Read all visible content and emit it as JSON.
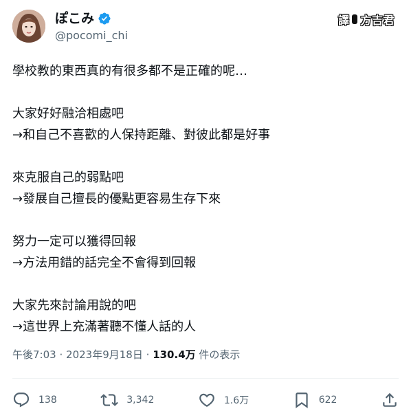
{
  "author": {
    "display_name": "ぽこみ",
    "handle": "@pocomi_chi"
  },
  "watermark": {
    "left": "譯",
    "right": "方吉君"
  },
  "tweet": {
    "lines": [
      "學校教的東西真的有很多都不是正確的呢…",
      "",
      "大家好好融洽相處吧",
      "→和自己不喜歡的人保持距離、對彼此都是好事",
      "",
      "來克服自己的弱點吧",
      "→發展自己擅長的優點更容易生存下來",
      "",
      "努力一定可以獲得回報",
      "→方法用錯的話完全不會得到回報",
      "",
      "大家先來討論用說的吧",
      "→這世界上充滿著聽不懂人話的人"
    ]
  },
  "meta": {
    "time": "午後7:03",
    "separator": "·",
    "date": "2023年9月18日",
    "views_count": "130.4万",
    "views_label": "件の表示"
  },
  "actions": {
    "reply": {
      "icon": "reply-icon",
      "count": "138"
    },
    "retweet": {
      "icon": "retweet-icon",
      "count": "3,342"
    },
    "like": {
      "icon": "heart-icon",
      "count": "1.6万"
    },
    "bookmark": {
      "icon": "bookmark-icon",
      "count": "622"
    },
    "share": {
      "icon": "share-icon"
    }
  },
  "colors": {
    "verified": "#1d9bf0",
    "text": "#0f1419",
    "muted": "#536471",
    "divider": "#eff3f4"
  }
}
